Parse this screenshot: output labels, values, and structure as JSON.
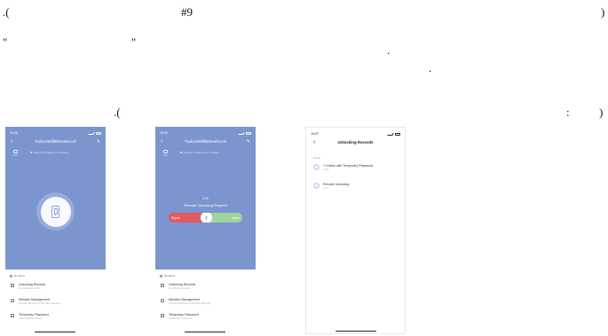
{
  "doc": {
    "line1_left": ".(",
    "line1_mid": "#9",
    "line1_right": ")",
    "line2_q1": "\"",
    "line2_q2": "\"",
    "line2_dot": ".",
    "line3_dot": ".",
    "line4_left": ".(",
    "line4_colon": ":",
    "line4_paren": ")"
  },
  "screen1": {
    "time": "10:06",
    "title": "TuoboxWifiBtSmartLock",
    "lock_label": "Lock",
    "security": "Security Protection on (7days)",
    "sheet_header": "No alerts",
    "items": [
      {
        "title": "Unlocking Records",
        "subtitle": "No unlocking records"
      },
      {
        "title": "Member Management",
        "subtitle": "a Family Members & Add Other Members"
      },
      {
        "title": "Temporary Password",
        "subtitle": "Unlock With Password"
      }
    ]
  },
  "screen2": {
    "time": "10:06",
    "title": "TuoboxWifiBtSmartLock",
    "lock_label": "Lock",
    "security": "Security Protection on (7days)",
    "timer": "27s",
    "request": "Remote Unlocking Request",
    "reject": "Reject",
    "agree": "Agree",
    "sheet_header": "No alerts",
    "items": [
      {
        "title": "Unlocking Records",
        "subtitle": "No unlocking records"
      },
      {
        "title": "Member Management",
        "subtitle": "a Family Members & Add Other Members"
      },
      {
        "title": "Temporary Password",
        "subtitle": "Unlock With Password"
      }
    ]
  },
  "screen3": {
    "time": "10:07",
    "title": "Unlocking Records",
    "section": "Today",
    "records": [
      {
        "title": "? Unlock with Temporary Password",
        "time": "10:06"
      },
      {
        "title": "Remote Unlocking",
        "time": "10:06"
      }
    ]
  }
}
